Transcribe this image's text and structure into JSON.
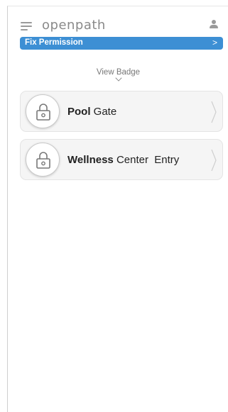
{
  "header": {
    "brand": "openpath",
    "menu_icon": "hamburger-menu-icon",
    "user_icon": "user-icon"
  },
  "banner": {
    "label": "Fix Permission",
    "chevron": ">",
    "color": "#3d8fd4"
  },
  "view_badge": {
    "label": "View Badge",
    "icon": "chevron-down-icon"
  },
  "entries": [
    {
      "bold": "Pool",
      "rest": "Gate",
      "icon": "lock-icon"
    },
    {
      "bold": "Wellness",
      "rest": "Center  Entry",
      "icon": "lock-icon"
    }
  ]
}
